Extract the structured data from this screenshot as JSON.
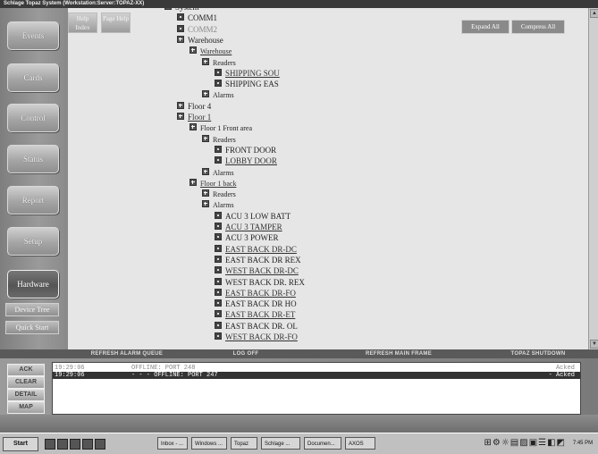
{
  "window": {
    "title": "Schlage Topaz System (Workstation:Server:TOPAZ-XX)"
  },
  "sidebar": {
    "items": [
      {
        "label": "Events"
      },
      {
        "label": "Cards"
      },
      {
        "label": "Control"
      },
      {
        "label": "Status"
      },
      {
        "label": "Report"
      },
      {
        "label": "Setup"
      },
      {
        "label": "Hardware"
      }
    ],
    "device_tree_label": "Device Tree",
    "quick_start_label": "Quick Start"
  },
  "help": {
    "index_label": "Help Index",
    "page_label": "Page Help"
  },
  "toolbar": {
    "expand_all": "Expand All",
    "compress_all": "Compress All"
  },
  "tree": [
    {
      "label": "System",
      "level": 0,
      "icon": "box",
      "dim": false,
      "link": false
    },
    {
      "label": "COMM1",
      "level": 1,
      "icon": "dot",
      "dim": false,
      "link": false
    },
    {
      "label": "COMM2",
      "level": 1,
      "icon": "dot",
      "dim": true,
      "link": false
    },
    {
      "label": "Warehouse",
      "level": 1,
      "icon": "plus",
      "dim": false,
      "link": false
    },
    {
      "label": "Warehouse",
      "level": 2,
      "icon": "plus",
      "dim": false,
      "link": true
    },
    {
      "label": "Readers",
      "level": 3,
      "icon": "plus",
      "dim": false,
      "link": false
    },
    {
      "label": "SHIPPING SOU",
      "level": 4,
      "icon": "dot",
      "dim": false,
      "link": true
    },
    {
      "label": "SHIPPING EAS",
      "level": 4,
      "icon": "dot",
      "dim": false,
      "link": false
    },
    {
      "label": "Alarms",
      "level": 3,
      "icon": "plus",
      "dim": false,
      "link": false
    },
    {
      "label": "Floor 4",
      "level": 1,
      "icon": "plus",
      "dim": false,
      "link": false
    },
    {
      "label": "Floor 1",
      "level": 1,
      "icon": "plus",
      "dim": false,
      "link": true
    },
    {
      "label": "Floor 1 Front area",
      "level": 2,
      "icon": "plus",
      "dim": false,
      "link": false
    },
    {
      "label": "Readers",
      "level": 3,
      "icon": "plus",
      "dim": false,
      "link": false
    },
    {
      "label": "FRONT DOOR",
      "level": 4,
      "icon": "dot",
      "dim": false,
      "link": false
    },
    {
      "label": "LOBBY DOOR",
      "level": 4,
      "icon": "dot",
      "dim": false,
      "link": true
    },
    {
      "label": "Alarms",
      "level": 3,
      "icon": "plus",
      "dim": false,
      "link": false
    },
    {
      "label": "Floor 1 back",
      "level": 2,
      "icon": "plus",
      "dim": false,
      "link": true
    },
    {
      "label": "Readers",
      "level": 3,
      "icon": "plus",
      "dim": false,
      "link": false
    },
    {
      "label": "Alarms",
      "level": 3,
      "icon": "plus",
      "dim": false,
      "link": false
    },
    {
      "label": "ACU 3 LOW BATT",
      "level": 4,
      "icon": "dot",
      "dim": false,
      "link": false
    },
    {
      "label": "ACU 3 TAMPER",
      "level": 4,
      "icon": "dot",
      "dim": false,
      "link": true
    },
    {
      "label": "ACU 3 POWER",
      "level": 4,
      "icon": "dot",
      "dim": false,
      "link": false
    },
    {
      "label": "EAST BACK DR-DC",
      "level": 4,
      "icon": "dot",
      "dim": false,
      "link": true
    },
    {
      "label": "EAST BACK DR REX",
      "level": 4,
      "icon": "dot",
      "dim": false,
      "link": false
    },
    {
      "label": "WEST BACK DR-DC",
      "level": 4,
      "icon": "dot",
      "dim": false,
      "link": true
    },
    {
      "label": "WEST BACK DR. REX",
      "level": 4,
      "icon": "dot",
      "dim": false,
      "link": false
    },
    {
      "label": "EAST BACK DR-FO",
      "level": 4,
      "icon": "dot",
      "dim": false,
      "link": true
    },
    {
      "label": "EAST BACK DR HO",
      "level": 4,
      "icon": "dot",
      "dim": false,
      "link": false
    },
    {
      "label": "EAST BACK DR-ET",
      "level": 4,
      "icon": "dot",
      "dim": false,
      "link": true
    },
    {
      "label": "EAST BACK DR. OL",
      "level": 4,
      "icon": "dot",
      "dim": false,
      "link": false
    },
    {
      "label": "WEST BACK DR-FO",
      "level": 4,
      "icon": "dot",
      "dim": false,
      "link": true
    }
  ],
  "menubar": {
    "refresh_alarm_queue": "REFRESH ALARM QUEUE",
    "log_off": "LOG OFF",
    "refresh_main_frame": "REFRESH MAIN FRAME",
    "topaz_shutdown": "TOPAZ SHUTDOWN"
  },
  "alarm_buttons": {
    "ack": "ACK",
    "clear": "CLEAR",
    "detail": "DETAIL",
    "map": "MAP"
  },
  "alarms": [
    {
      "time": "19:29:06",
      "message": "OFFLINE: PORT 248",
      "status": "Acked",
      "selected": false
    },
    {
      "time": "19:29:06",
      "message": "- - - OFFLINE: PORT 247",
      "status": "- Acked",
      "selected": true
    }
  ],
  "taskbar": {
    "start": "Start",
    "tasks": [
      "Inbox - ...",
      "Windows ...",
      "Topaz",
      "Schlage ...",
      "Documen...",
      "AXOS"
    ],
    "clock": "7:45 PM",
    "tray": "⊞⚙☼▤▨▣☰◧◩"
  },
  "colors": {
    "tree_bg": "#e6e6e6",
    "selected_row": "#333333"
  }
}
